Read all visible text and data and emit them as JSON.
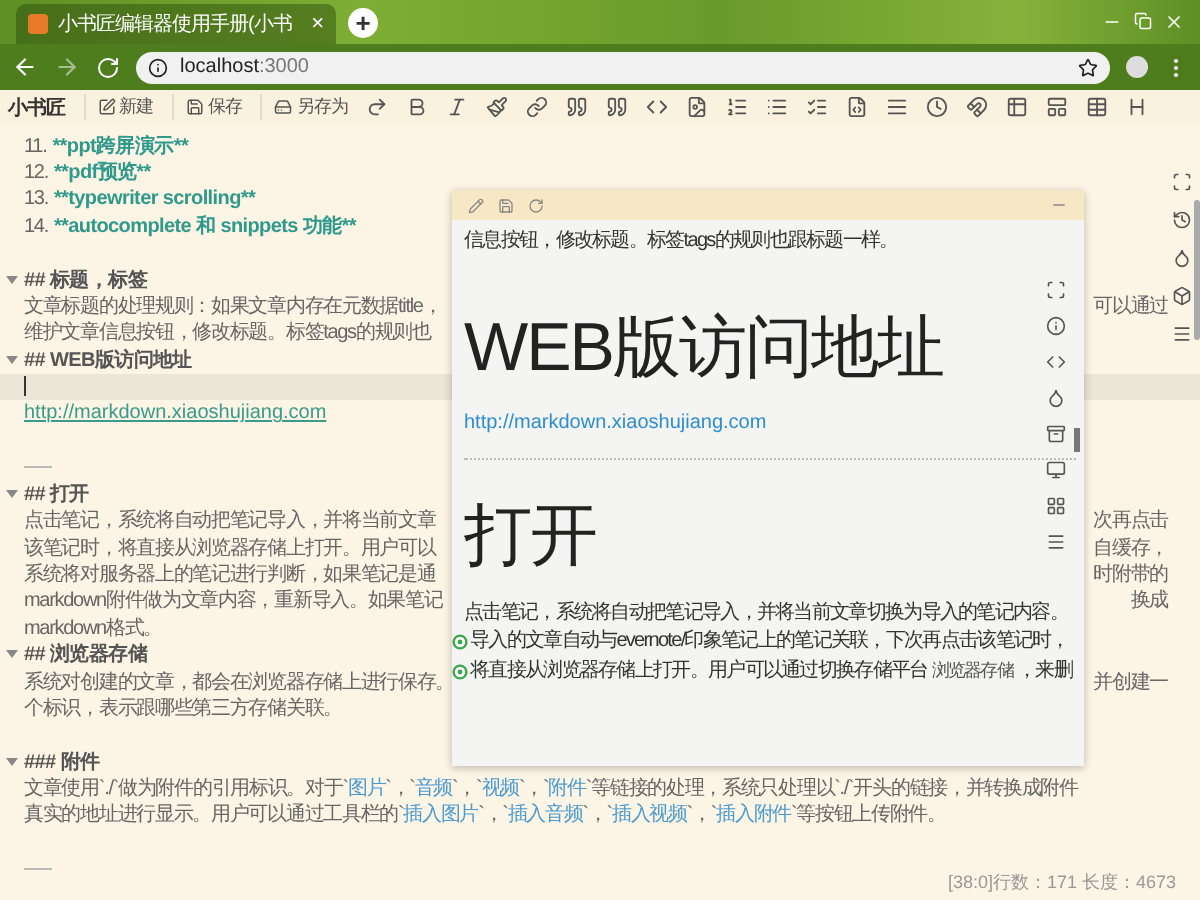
{
  "browser": {
    "tab": {
      "title": "小书匠编辑器使用手册(小书",
      "close": "×"
    },
    "new_tab": "+",
    "url": {
      "host": "localhost",
      "port": ":3000"
    }
  },
  "toolbar": {
    "logo": "小书匠",
    "buttons": [
      {
        "kind": "new",
        "label": "新建"
      },
      {
        "kind": "save",
        "label": "保存"
      },
      {
        "kind": "saveas",
        "label": "另存为"
      }
    ]
  },
  "editor": {
    "lines": [
      {
        "kind": "list",
        "number": "11.",
        "text": "**ppt跨屏演示**"
      },
      {
        "kind": "list",
        "number": "12.",
        "text": "**pdf预览**"
      },
      {
        "kind": "list",
        "number": "13.",
        "text": "**typewriter scrolling**"
      },
      {
        "kind": "list",
        "number": "14.",
        "text": "**autocomplete 和 snippets 功能**"
      },
      {
        "kind": "blank"
      },
      {
        "kind": "heading",
        "text": "## 标题，标签"
      },
      {
        "kind": "text",
        "text": "文章标题的处理规则：如果文章内存在元数据title，",
        "right": "可以通过"
      },
      {
        "kind": "text",
        "text": "维护文章信息按钮，修改标题。标签tags的规则也"
      },
      {
        "kind": "heading",
        "text": "## WEB版访问地址"
      },
      {
        "kind": "cursor"
      },
      {
        "kind": "link",
        "text": "http://markdown.xiaoshujiang.com"
      },
      {
        "kind": "blank"
      },
      {
        "kind": "rule"
      },
      {
        "kind": "heading",
        "text": "## 打开"
      },
      {
        "kind": "text",
        "text": "点击笔记，系统将自动把笔记导入，并将当前文章",
        "right": "次再点击"
      },
      {
        "kind": "text",
        "text": "该笔记时，将直接从浏览器存储上打开。用户可以",
        "right": "自缓存，"
      },
      {
        "kind": "text",
        "text": "系统将对服务器上的笔记进行判断，如果笔记是通",
        "right": "时附带的"
      },
      {
        "kind": "text",
        "text": "markdown附件做为文章内容，重新导入。如果笔记",
        "right": "换成"
      },
      {
        "kind": "text",
        "text": "markdown格式。"
      },
      {
        "kind": "heading",
        "text": "## 浏览器存储"
      },
      {
        "kind": "text",
        "text": "系统对创建的文章，都会在浏览器存储上进行保存。",
        "right": "并创建一"
      },
      {
        "kind": "text",
        "text": "个标识，表示跟哪些第三方存储关联。"
      },
      {
        "kind": "blank"
      },
      {
        "kind": "heading",
        "text": "### 附件"
      },
      {
        "kind": "mixed",
        "segments": [
          {
            "text": "文章使用`./`做为附件的引用标识。对于`",
            "code": false
          },
          {
            "text": "图片",
            "code": true
          },
          {
            "text": "`，`",
            "code": false
          },
          {
            "text": "音频",
            "code": true
          },
          {
            "text": "`，`",
            "code": false
          },
          {
            "text": "视频",
            "code": true
          },
          {
            "text": "`，`",
            "code": false
          },
          {
            "text": "附件",
            "code": true
          },
          {
            "text": "`等链接的处理，系统只处理以`./`开头的链接，并转换成附件",
            "code": false
          }
        ]
      },
      {
        "kind": "mixed",
        "segments": [
          {
            "text": "真实的地址进行显示。用户可以通过工具栏的`",
            "code": false
          },
          {
            "text": "插入图片",
            "code": true
          },
          {
            "text": "`，`",
            "code": false
          },
          {
            "text": "插入音频",
            "code": true
          },
          {
            "text": "`，`",
            "code": false
          },
          {
            "text": "插入视频",
            "code": true
          },
          {
            "text": "`，`",
            "code": false
          },
          {
            "text": "插入附件",
            "code": true
          },
          {
            "text": "`等按钮上传附件。",
            "code": false
          }
        ]
      },
      {
        "kind": "blank"
      },
      {
        "kind": "rule"
      }
    ],
    "status": "[38:0]行数：171 长度：4673"
  },
  "preview": {
    "blocks": [
      {
        "kind": "text",
        "text": "信息按钮，修改标题。标签tags的规则也跟标题一样。"
      },
      {
        "kind": "h1",
        "text": "WEB版访问地址"
      },
      {
        "kind": "link",
        "text": "http://markdown.xiaoshujiang.com"
      },
      {
        "kind": "hr"
      },
      {
        "kind": "h1",
        "text": "打开"
      },
      {
        "kind": "text",
        "text": "点击笔记，系统将自动把笔记导入，并将当前文章切换为导入的笔记内容。"
      },
      {
        "kind": "marked",
        "text": "导入的文章自动与evernote/印象笔记上的笔记关联，下次再点击该笔记时，"
      },
      {
        "kind": "marked",
        "text": "将直接从浏览器存储上打开。用户可以通过切换存储平台",
        "tag": "浏览器存储",
        "after": "，来删"
      }
    ]
  }
}
